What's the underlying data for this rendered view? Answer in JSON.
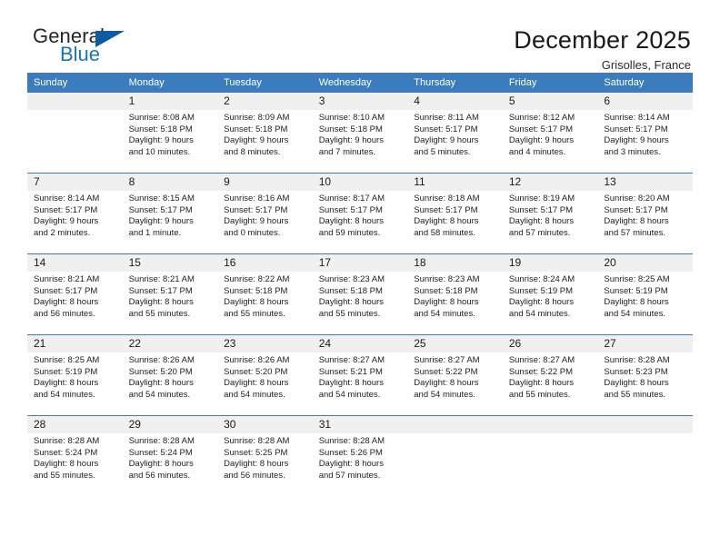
{
  "brand": {
    "name_part1": "General",
    "name_part2": "Blue",
    "triangle_color": "#0b5ca0",
    "blue_color": "#1b75bc"
  },
  "header": {
    "title": "December 2025",
    "subtitle": "Grisolles, France",
    "header_bg": "#3b7cbf",
    "daynum_bg": "#f0f0f0"
  },
  "weekdays": [
    "Sunday",
    "Monday",
    "Tuesday",
    "Wednesday",
    "Thursday",
    "Friday",
    "Saturday"
  ],
  "weeks": [
    [
      {
        "day": "",
        "sunrise": "",
        "sunset": "",
        "daylight_line1": "",
        "daylight_line2": ""
      },
      {
        "day": "1",
        "sunrise": "Sunrise: 8:08 AM",
        "sunset": "Sunset: 5:18 PM",
        "daylight_line1": "Daylight: 9 hours",
        "daylight_line2": "and 10 minutes."
      },
      {
        "day": "2",
        "sunrise": "Sunrise: 8:09 AM",
        "sunset": "Sunset: 5:18 PM",
        "daylight_line1": "Daylight: 9 hours",
        "daylight_line2": "and 8 minutes."
      },
      {
        "day": "3",
        "sunrise": "Sunrise: 8:10 AM",
        "sunset": "Sunset: 5:18 PM",
        "daylight_line1": "Daylight: 9 hours",
        "daylight_line2": "and 7 minutes."
      },
      {
        "day": "4",
        "sunrise": "Sunrise: 8:11 AM",
        "sunset": "Sunset: 5:17 PM",
        "daylight_line1": "Daylight: 9 hours",
        "daylight_line2": "and 5 minutes."
      },
      {
        "day": "5",
        "sunrise": "Sunrise: 8:12 AM",
        "sunset": "Sunset: 5:17 PM",
        "daylight_line1": "Daylight: 9 hours",
        "daylight_line2": "and 4 minutes."
      },
      {
        "day": "6",
        "sunrise": "Sunrise: 8:14 AM",
        "sunset": "Sunset: 5:17 PM",
        "daylight_line1": "Daylight: 9 hours",
        "daylight_line2": "and 3 minutes."
      }
    ],
    [
      {
        "day": "7",
        "sunrise": "Sunrise: 8:14 AM",
        "sunset": "Sunset: 5:17 PM",
        "daylight_line1": "Daylight: 9 hours",
        "daylight_line2": "and 2 minutes."
      },
      {
        "day": "8",
        "sunrise": "Sunrise: 8:15 AM",
        "sunset": "Sunset: 5:17 PM",
        "daylight_line1": "Daylight: 9 hours",
        "daylight_line2": "and 1 minute."
      },
      {
        "day": "9",
        "sunrise": "Sunrise: 8:16 AM",
        "sunset": "Sunset: 5:17 PM",
        "daylight_line1": "Daylight: 9 hours",
        "daylight_line2": "and 0 minutes."
      },
      {
        "day": "10",
        "sunrise": "Sunrise: 8:17 AM",
        "sunset": "Sunset: 5:17 PM",
        "daylight_line1": "Daylight: 8 hours",
        "daylight_line2": "and 59 minutes."
      },
      {
        "day": "11",
        "sunrise": "Sunrise: 8:18 AM",
        "sunset": "Sunset: 5:17 PM",
        "daylight_line1": "Daylight: 8 hours",
        "daylight_line2": "and 58 minutes."
      },
      {
        "day": "12",
        "sunrise": "Sunrise: 8:19 AM",
        "sunset": "Sunset: 5:17 PM",
        "daylight_line1": "Daylight: 8 hours",
        "daylight_line2": "and 57 minutes."
      },
      {
        "day": "13",
        "sunrise": "Sunrise: 8:20 AM",
        "sunset": "Sunset: 5:17 PM",
        "daylight_line1": "Daylight: 8 hours",
        "daylight_line2": "and 57 minutes."
      }
    ],
    [
      {
        "day": "14",
        "sunrise": "Sunrise: 8:21 AM",
        "sunset": "Sunset: 5:17 PM",
        "daylight_line1": "Daylight: 8 hours",
        "daylight_line2": "and 56 minutes."
      },
      {
        "day": "15",
        "sunrise": "Sunrise: 8:21 AM",
        "sunset": "Sunset: 5:17 PM",
        "daylight_line1": "Daylight: 8 hours",
        "daylight_line2": "and 55 minutes."
      },
      {
        "day": "16",
        "sunrise": "Sunrise: 8:22 AM",
        "sunset": "Sunset: 5:18 PM",
        "daylight_line1": "Daylight: 8 hours",
        "daylight_line2": "and 55 minutes."
      },
      {
        "day": "17",
        "sunrise": "Sunrise: 8:23 AM",
        "sunset": "Sunset: 5:18 PM",
        "daylight_line1": "Daylight: 8 hours",
        "daylight_line2": "and 55 minutes."
      },
      {
        "day": "18",
        "sunrise": "Sunrise: 8:23 AM",
        "sunset": "Sunset: 5:18 PM",
        "daylight_line1": "Daylight: 8 hours",
        "daylight_line2": "and 54 minutes."
      },
      {
        "day": "19",
        "sunrise": "Sunrise: 8:24 AM",
        "sunset": "Sunset: 5:19 PM",
        "daylight_line1": "Daylight: 8 hours",
        "daylight_line2": "and 54 minutes."
      },
      {
        "day": "20",
        "sunrise": "Sunrise: 8:25 AM",
        "sunset": "Sunset: 5:19 PM",
        "daylight_line1": "Daylight: 8 hours",
        "daylight_line2": "and 54 minutes."
      }
    ],
    [
      {
        "day": "21",
        "sunrise": "Sunrise: 8:25 AM",
        "sunset": "Sunset: 5:19 PM",
        "daylight_line1": "Daylight: 8 hours",
        "daylight_line2": "and 54 minutes."
      },
      {
        "day": "22",
        "sunrise": "Sunrise: 8:26 AM",
        "sunset": "Sunset: 5:20 PM",
        "daylight_line1": "Daylight: 8 hours",
        "daylight_line2": "and 54 minutes."
      },
      {
        "day": "23",
        "sunrise": "Sunrise: 8:26 AM",
        "sunset": "Sunset: 5:20 PM",
        "daylight_line1": "Daylight: 8 hours",
        "daylight_line2": "and 54 minutes."
      },
      {
        "day": "24",
        "sunrise": "Sunrise: 8:27 AM",
        "sunset": "Sunset: 5:21 PM",
        "daylight_line1": "Daylight: 8 hours",
        "daylight_line2": "and 54 minutes."
      },
      {
        "day": "25",
        "sunrise": "Sunrise: 8:27 AM",
        "sunset": "Sunset: 5:22 PM",
        "daylight_line1": "Daylight: 8 hours",
        "daylight_line2": "and 54 minutes."
      },
      {
        "day": "26",
        "sunrise": "Sunrise: 8:27 AM",
        "sunset": "Sunset: 5:22 PM",
        "daylight_line1": "Daylight: 8 hours",
        "daylight_line2": "and 55 minutes."
      },
      {
        "day": "27",
        "sunrise": "Sunrise: 8:28 AM",
        "sunset": "Sunset: 5:23 PM",
        "daylight_line1": "Daylight: 8 hours",
        "daylight_line2": "and 55 minutes."
      }
    ],
    [
      {
        "day": "28",
        "sunrise": "Sunrise: 8:28 AM",
        "sunset": "Sunset: 5:24 PM",
        "daylight_line1": "Daylight: 8 hours",
        "daylight_line2": "and 55 minutes."
      },
      {
        "day": "29",
        "sunrise": "Sunrise: 8:28 AM",
        "sunset": "Sunset: 5:24 PM",
        "daylight_line1": "Daylight: 8 hours",
        "daylight_line2": "and 56 minutes."
      },
      {
        "day": "30",
        "sunrise": "Sunrise: 8:28 AM",
        "sunset": "Sunset: 5:25 PM",
        "daylight_line1": "Daylight: 8 hours",
        "daylight_line2": "and 56 minutes."
      },
      {
        "day": "31",
        "sunrise": "Sunrise: 8:28 AM",
        "sunset": "Sunset: 5:26 PM",
        "daylight_line1": "Daylight: 8 hours",
        "daylight_line2": "and 57 minutes."
      },
      {
        "day": "",
        "sunrise": "",
        "sunset": "",
        "daylight_line1": "",
        "daylight_line2": ""
      },
      {
        "day": "",
        "sunrise": "",
        "sunset": "",
        "daylight_line1": "",
        "daylight_line2": ""
      },
      {
        "day": "",
        "sunrise": "",
        "sunset": "",
        "daylight_line1": "",
        "daylight_line2": ""
      }
    ]
  ]
}
